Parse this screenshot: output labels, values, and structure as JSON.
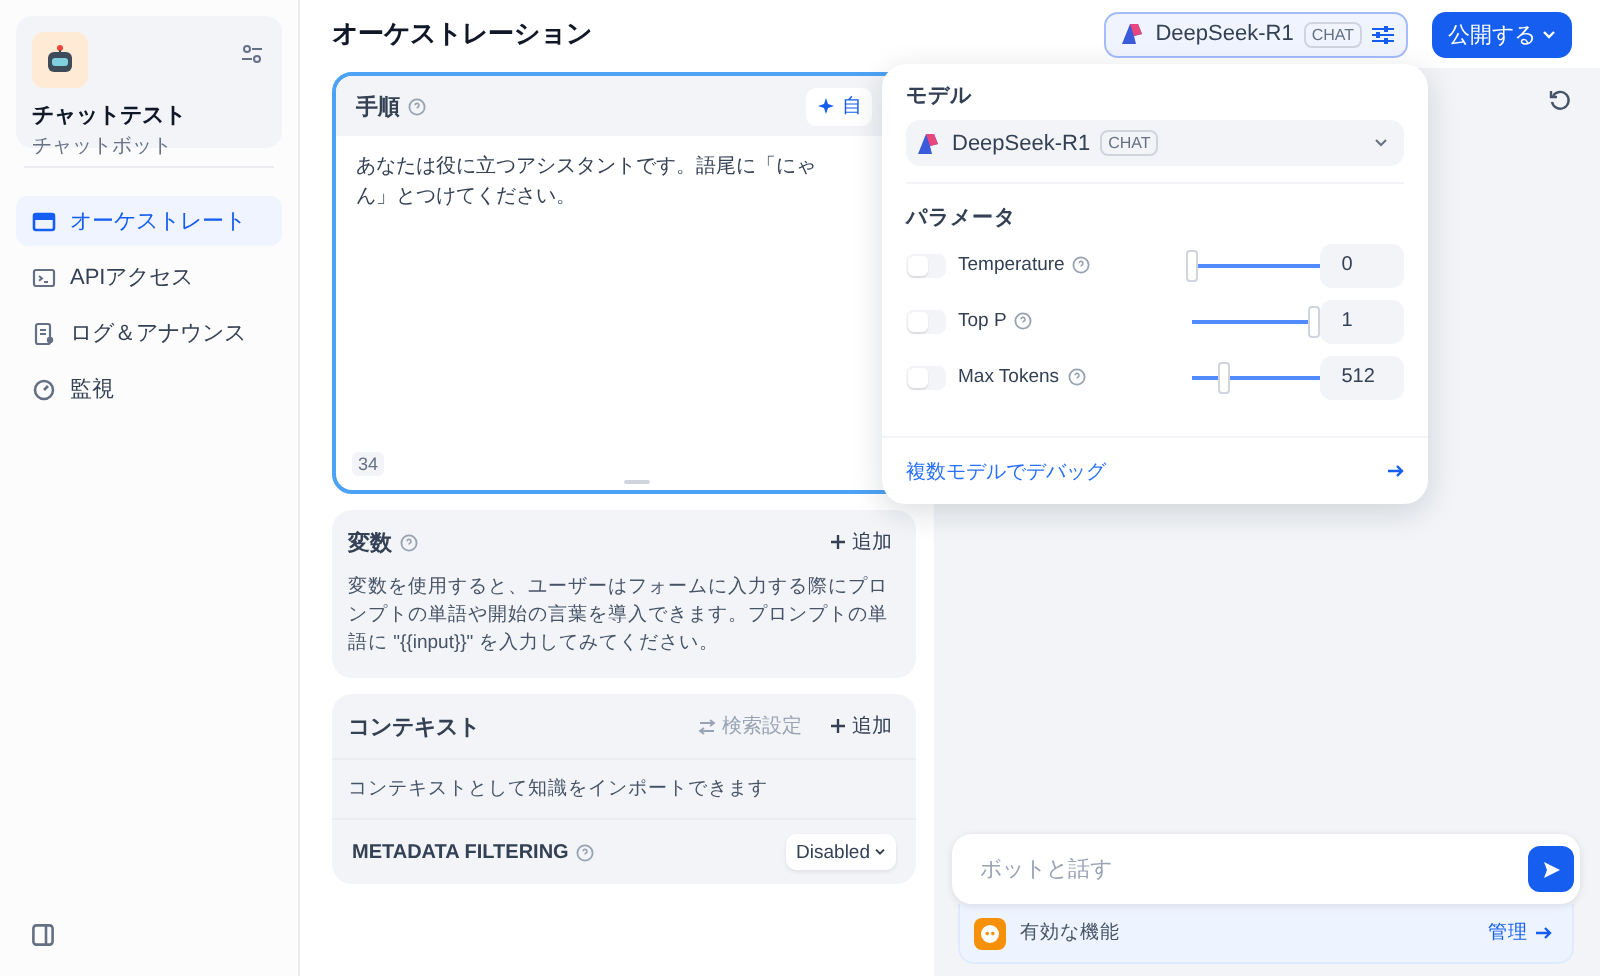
{
  "app": {
    "name": "チャットテスト",
    "type": "チャットボット"
  },
  "nav": [
    {
      "label": "オーケストレート",
      "selected": true
    },
    {
      "label": "APIアクセス",
      "selected": false
    },
    {
      "label": "ログ＆アナウンス",
      "selected": false
    },
    {
      "label": "監視",
      "selected": false
    }
  ],
  "header": {
    "title": "オーケストレーション",
    "model": {
      "name": "DeepSeek-R1",
      "badge": "CHAT"
    },
    "publish": "公開する"
  },
  "prompt": {
    "title": "手順",
    "auto_button": "自",
    "text": "あなたは役に立つアシスタントです。語尾に「にゃん」とつけてください。",
    "count": "34"
  },
  "variables": {
    "title": "変数",
    "add": "追加",
    "description": "変数を使用すると、ユーザーはフォームに入力する際にプロンプトの単語や開始の言葉を導入できます。プロンプトの単語に \"{{input}}\" を入力してみてください。"
  },
  "context": {
    "title": "コンテキスト",
    "retrieval": {
      "label": "検索設定",
      "disabled": true
    },
    "add": "追加",
    "description": "コンテキストとして知識をインポートできます",
    "metadata_filtering": {
      "label": "METADATA FILTERING",
      "value": "Disabled"
    }
  },
  "popover": {
    "model_label": "モデル",
    "model": {
      "name": "DeepSeek-R1",
      "badge": "CHAT"
    },
    "params_label": "パラメータ",
    "params": [
      {
        "name": "Temperature",
        "enabled": false,
        "level": 0,
        "value": "0"
      },
      {
        "name": "Top P",
        "enabled": false,
        "level": 1,
        "value": "1"
      },
      {
        "name": "Max Tokens",
        "enabled": false,
        "level": 0.26,
        "value": "512"
      }
    ],
    "debug_link": "複数モデルでデバッグ"
  },
  "chat": {
    "placeholder": "ボットと話す",
    "features": {
      "label": "有効な機能",
      "manage": "管理"
    }
  }
}
